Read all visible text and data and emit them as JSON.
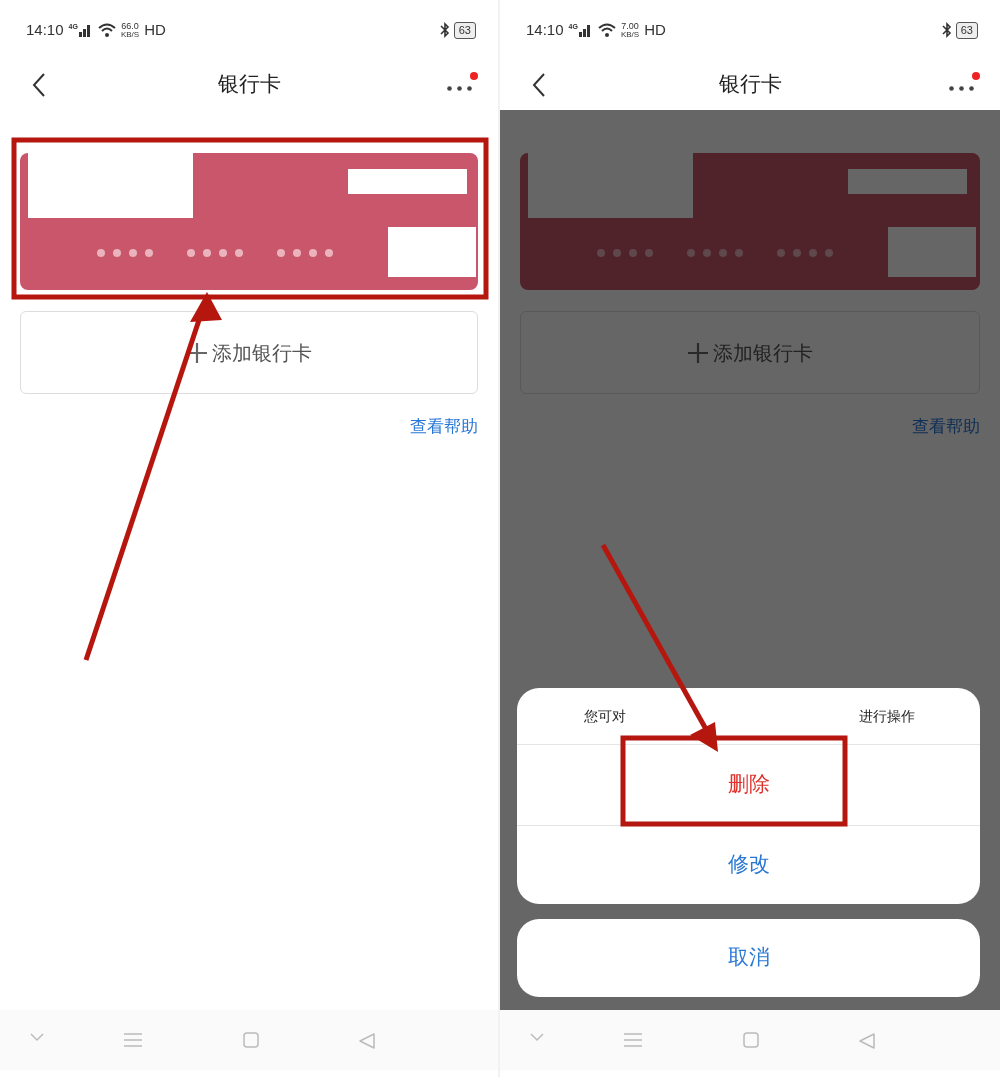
{
  "screens": [
    {
      "status_bar": {
        "time": "14:10",
        "network": "4G",
        "speed": "66.0",
        "speed_unit": "KB/S",
        "hd": "HD",
        "battery": "63"
      },
      "nav": {
        "title": "银行卡",
        "notification": true
      },
      "card": {
        "redacted": true
      },
      "add_button": "添加银行卡",
      "help_link": "查看帮助",
      "dimmed": false,
      "annotations": [
        {
          "kind": "card-frame"
        },
        {
          "kind": "arrow-to-card"
        }
      ]
    },
    {
      "status_bar": {
        "time": "14:10",
        "network": "4G",
        "speed": "7.00",
        "speed_unit": "KB/S",
        "hd": "HD",
        "battery": "63"
      },
      "nav": {
        "title": "银行卡",
        "notification": true
      },
      "card": {
        "redacted": true
      },
      "add_button": "添加银行卡",
      "help_link": "查看帮助",
      "dimmed": true,
      "sheet": {
        "message_start": "您可对",
        "message_end": "进行操作",
        "actions": [
          {
            "label": "删除",
            "kind": "destructive"
          },
          {
            "label": "修改",
            "kind": "normal"
          }
        ],
        "cancel": "取消"
      },
      "annotations": [
        {
          "kind": "action-frame"
        },
        {
          "kind": "arrow-to-action"
        }
      ]
    }
  ]
}
